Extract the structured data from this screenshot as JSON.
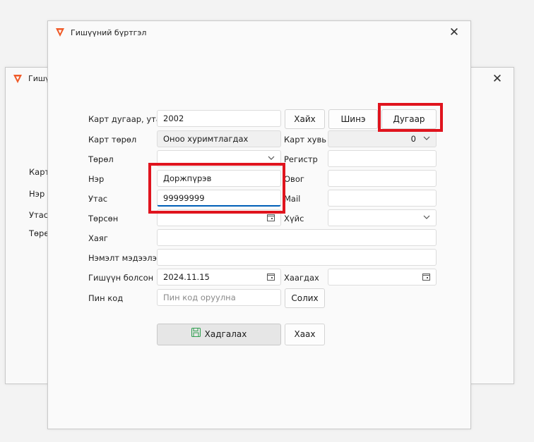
{
  "background_window": {
    "title": "Гишүү",
    "labels": [
      "Карт",
      "Нэр",
      "Утас",
      "Төрө"
    ]
  },
  "dialog": {
    "title": "Гишүүний бүртгэл",
    "labels": {
      "card": "Карт дугаар, утас",
      "card_type": "Карт төрөл",
      "type": "Төрөл",
      "name": "Нэр",
      "phone": "Утас",
      "birth": "Төрсөн",
      "address": "Хаяг",
      "extra": "Нэмэлт мэдээлэл",
      "joined": "Гишүүн болсон",
      "pin": "Пин код",
      "card_share": "Карт хувь",
      "register": "Регистр",
      "surname": "Овог",
      "mail": "Mail",
      "gender": "Хүйс",
      "close_date": "Хаагдах"
    },
    "values": {
      "card": "2002",
      "card_type": "Оноо хуримтлагдах",
      "type": "",
      "name": "Доржпүрэв",
      "phone": "99999999",
      "birth": "",
      "address": "",
      "extra": "",
      "joined": "2024.11.15",
      "card_share": "0",
      "register": "",
      "surname": "",
      "mail": "",
      "gender": "",
      "close_date": ""
    },
    "placeholders": {
      "pin": "Пин код оруулна"
    },
    "buttons": {
      "search": "Хайх",
      "new": "Шинэ",
      "number": "Дугаар",
      "change": "Солих",
      "save": "Хадгалах",
      "close": "Хаах"
    }
  },
  "colors": {
    "highlight": "#e0141e",
    "accent": "#005fb8",
    "save_icon": "#2e9e4f",
    "app_icon": "#f05a28"
  },
  "icons": [
    "app-logo-icon",
    "close-icon",
    "chevron-down-icon",
    "calendar-icon",
    "save-icon"
  ]
}
